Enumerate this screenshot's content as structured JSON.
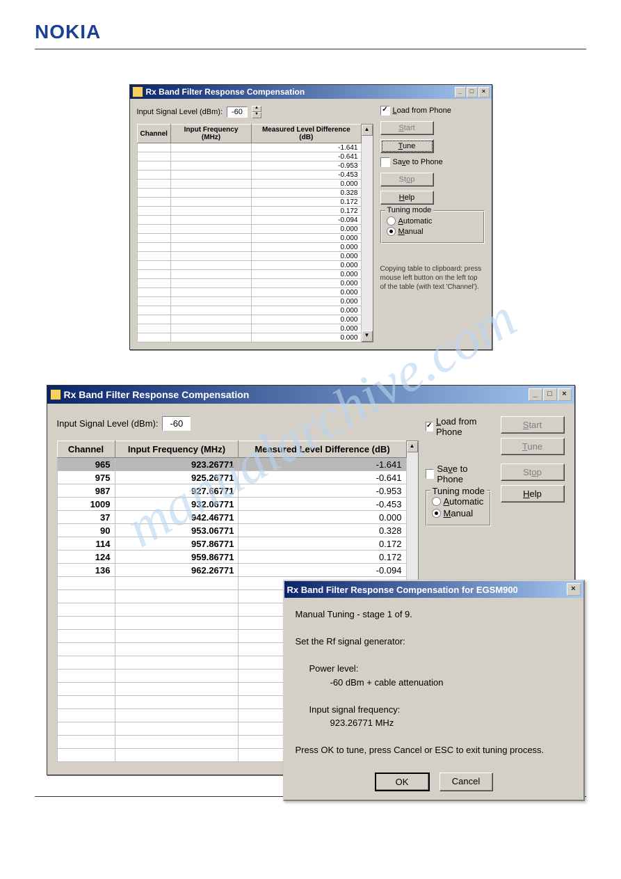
{
  "brand": "NOKIA",
  "watermark": "manualarchive.com",
  "win1": {
    "title": "Rx Band Filter Response Compensation",
    "signal_label": "Input Signal Level (dBm):",
    "signal_value": "-60",
    "cols": {
      "c1": "Channel",
      "c2": "Input Frequency (MHz)",
      "c3": "Measured Level Difference (dB)"
    },
    "rows": [
      {
        "ch": "",
        "freq": "",
        "diff": "-1.641"
      },
      {
        "ch": "",
        "freq": "",
        "diff": "-0.641"
      },
      {
        "ch": "",
        "freq": "",
        "diff": "-0.953"
      },
      {
        "ch": "",
        "freq": "",
        "diff": "-0.453"
      },
      {
        "ch": "",
        "freq": "",
        "diff": "0.000"
      },
      {
        "ch": "",
        "freq": "",
        "diff": "0.328"
      },
      {
        "ch": "",
        "freq": "",
        "diff": "0.172"
      },
      {
        "ch": "",
        "freq": "",
        "diff": "0.172"
      },
      {
        "ch": "",
        "freq": "",
        "diff": "-0.094"
      },
      {
        "ch": "",
        "freq": "",
        "diff": "0.000"
      },
      {
        "ch": "",
        "freq": "",
        "diff": "0.000"
      },
      {
        "ch": "",
        "freq": "",
        "diff": "0.000"
      },
      {
        "ch": "",
        "freq": "",
        "diff": "0.000"
      },
      {
        "ch": "",
        "freq": "",
        "diff": "0.000"
      },
      {
        "ch": "",
        "freq": "",
        "diff": "0.000"
      },
      {
        "ch": "",
        "freq": "",
        "diff": "0.000"
      },
      {
        "ch": "",
        "freq": "",
        "diff": "0.000"
      },
      {
        "ch": "",
        "freq": "",
        "diff": "0.000"
      },
      {
        "ch": "",
        "freq": "",
        "diff": "0.000"
      },
      {
        "ch": "",
        "freq": "",
        "diff": "0.000"
      },
      {
        "ch": "",
        "freq": "",
        "diff": "0.000"
      },
      {
        "ch": "",
        "freq": "",
        "diff": "0.000"
      }
    ],
    "load_label": "Load from Phone",
    "save_label": "Save to Phone",
    "tuning_label": "Tuning mode",
    "auto_label": "Automatic",
    "manual_label": "Manual",
    "btn_start": "Start",
    "btn_tune": "Tune",
    "btn_stop": "Stop",
    "btn_help": "Help",
    "hint": "Copying table to clipboard: press mouse left button on the left top of the table (with text 'Channel')."
  },
  "win2": {
    "title": "Rx Band Filter Response Compensation",
    "signal_label": "Input Signal Level (dBm):",
    "signal_value": "-60",
    "cols": {
      "c1": "Channel",
      "c2": "Input Frequency (MHz)",
      "c3": "Measured Level Difference (dB)"
    },
    "rows": [
      {
        "ch": "965",
        "freq": "923.26771",
        "diff": "-1.641",
        "sel": true
      },
      {
        "ch": "975",
        "freq": "925.26771",
        "diff": "-0.641"
      },
      {
        "ch": "987",
        "freq": "927.66771",
        "diff": "-0.953"
      },
      {
        "ch": "1009",
        "freq": "932.06771",
        "diff": "-0.453"
      },
      {
        "ch": "37",
        "freq": "942.46771",
        "diff": "0.000"
      },
      {
        "ch": "90",
        "freq": "953.06771",
        "diff": "0.328"
      },
      {
        "ch": "114",
        "freq": "957.86771",
        "diff": "0.172"
      },
      {
        "ch": "124",
        "freq": "959.86771",
        "diff": "0.172"
      },
      {
        "ch": "136",
        "freq": "962.26771",
        "diff": "-0.094"
      }
    ],
    "empty_rows": 14,
    "load_label": "Load from Phone",
    "save_label": "Save to Phone",
    "tuning_label": "Tuning mode",
    "auto_label": "Automatic",
    "manual_label": "Manual",
    "btn_start": "Start",
    "btn_tune": "Tune",
    "btn_stop": "Stop",
    "btn_help": "Help"
  },
  "dialog": {
    "title": "Rx Band Filter Response Compensation for EGSM900",
    "line1": "Manual Tuning - stage 1 of 9.",
    "line2": "Set the Rf signal generator:",
    "line3": "Power level:",
    "line4": "-60 dBm + cable attenuation",
    "line5": "Input signal frequency:",
    "line6": "923.26771 MHz",
    "line7": "Press OK to tune, press Cancel or ESC to exit tuning process.",
    "ok": "OK",
    "cancel": "Cancel"
  }
}
